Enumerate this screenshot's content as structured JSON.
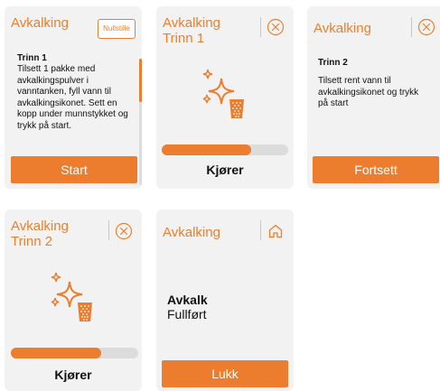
{
  "colors": {
    "accent": "#ec7d2e",
    "card_bg": "#f2f2f2",
    "track": "#dcdcdc"
  },
  "screens": {
    "start": {
      "title": "Avkalking",
      "reset_label": "Nullstille",
      "step_title": "Trinn 1",
      "step_text": "Tilsett 1 pakke med avkalkingspulver i vanntanken, fyll vann til avkalkingsikonet. Sett en kopp under munnstykket og trykk på start.",
      "button_label": "Start"
    },
    "running1": {
      "title": "Avkalking\nTrinn 1",
      "icon": "close-circle-icon",
      "status": "Kjører",
      "progress": 0.71
    },
    "step2": {
      "title": "Avkalking",
      "icon": "close-circle-icon",
      "step_title": "Trinn 2",
      "step_text": "Tilsett rent vann til avkalkingsikonet og trykk på start",
      "button_label": "Fortsett"
    },
    "running2": {
      "title": "Avkalking\nTrinn 2",
      "icon": "close-circle-icon",
      "status": "Kjører",
      "progress": 0.71
    },
    "done": {
      "title": "Avkalking",
      "icon": "home-icon",
      "heading": "Avkalk",
      "subheading": "Fullført",
      "button_label": "Lukk"
    }
  }
}
